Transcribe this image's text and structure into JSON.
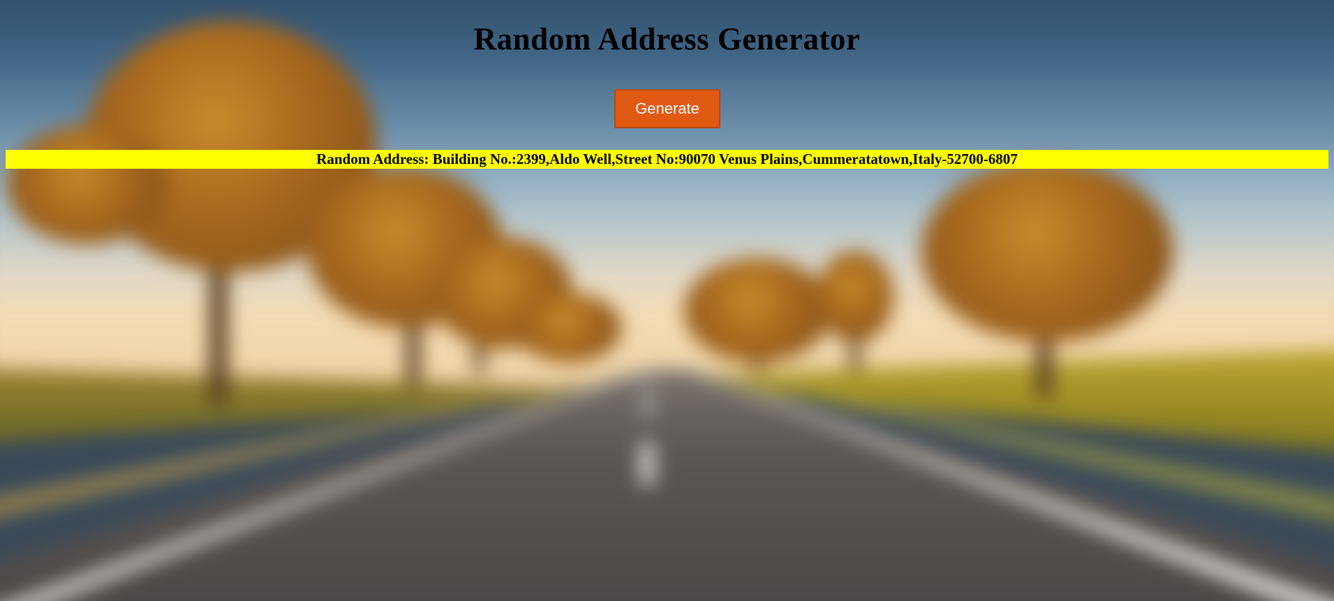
{
  "page": {
    "title": "Random Address Generator",
    "background_icon": "blurred-tree-lined-road-image"
  },
  "generate_button": {
    "label": "Generate",
    "color": "#e05a14"
  },
  "result": {
    "prefix": "Random Address: ",
    "address": "Building No.:2399,Aldo Well,Street No:90070 Venus Plains,Cummeratatown,Italy-52700-6807",
    "background_color": "#ffff00"
  }
}
